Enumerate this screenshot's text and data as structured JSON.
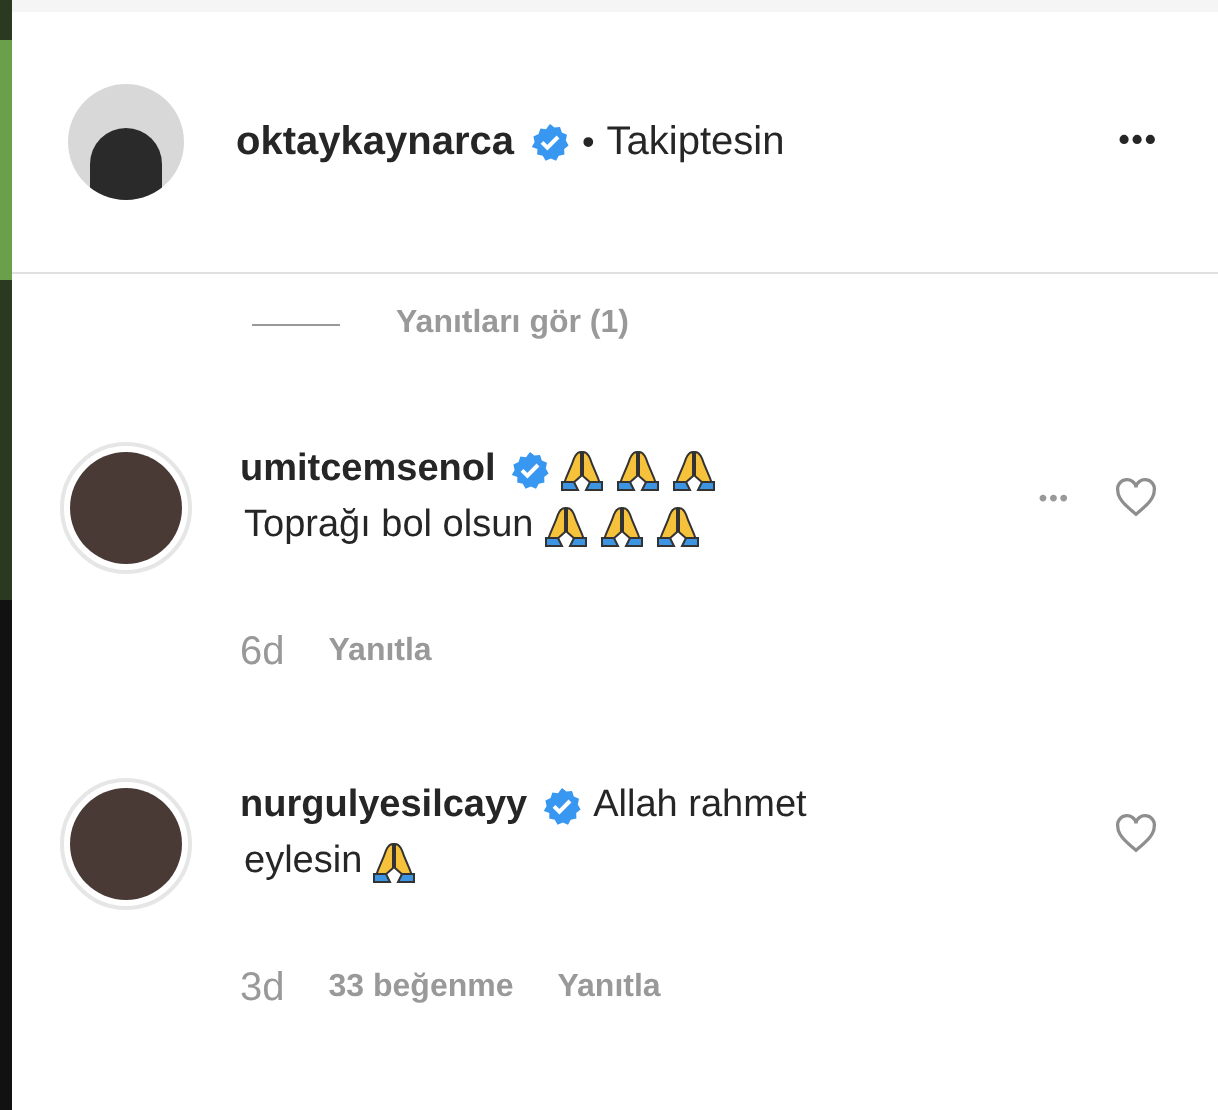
{
  "header": {
    "username": "oktaykaynarca",
    "verified": true,
    "separator": "•",
    "follow_status": "Takiptesin",
    "menu": "•••"
  },
  "replies_toggle": {
    "label": "Yanıtları gör (1)"
  },
  "comments": [
    {
      "username": "umitcemsenol",
      "verified": true,
      "lines": [
        {
          "emojis": [
            {
              "kind": "pray"
            },
            {
              "kind": "pray"
            },
            {
              "kind": "pray"
            }
          ]
        },
        {
          "text": "Toprağı bol olsun",
          "emojis": [
            {
              "kind": "pray"
            },
            {
              "kind": "pray"
            },
            {
              "kind": "pray"
            }
          ]
        }
      ],
      "more": "•••",
      "time": "6d",
      "reply": "Yanıtla"
    },
    {
      "username": "nurgulyesilcayy",
      "verified": true,
      "lines": [
        {
          "text": "Allah rahmet"
        },
        {
          "text": "eylesin",
          "emojis": [
            {
              "kind": "pray"
            }
          ]
        }
      ],
      "time": "3d",
      "likes": "33 beğenme",
      "reply": "Yanıtla"
    }
  ]
}
